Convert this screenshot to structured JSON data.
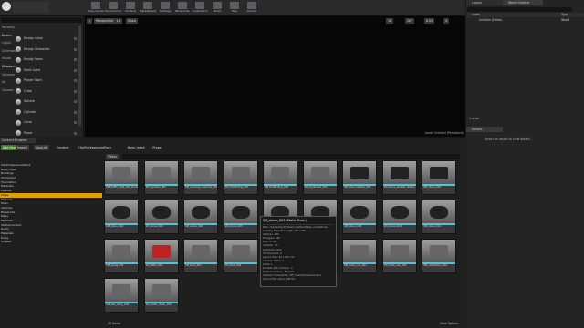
{
  "toolbar": {
    "buttons": [
      "Save Current",
      "Source Control",
      "Content",
      "Marketplace",
      "Settings",
      "Blueprints",
      "Cinematics",
      "Build",
      "Play",
      "Launch"
    ]
  },
  "left_panel": {
    "search_placeholder": "Search Classes",
    "categories": [
      "Recently Placed",
      "Basic",
      "Lights",
      "Cinematic",
      "Visual Effects",
      "Geometry",
      "Volumes",
      "All Classes"
    ],
    "items": [
      "Empty Actor",
      "Empty Character",
      "Empty Pawn",
      "Point Light",
      "Player Start",
      "Cube",
      "Sphere",
      "Cylinder",
      "Cone",
      "Plane"
    ]
  },
  "viewport": {
    "perspective": "Perspective",
    "lit": "Lit",
    "show": "Show",
    "snap_values": [
      "10",
      "10°",
      "0.25",
      "4"
    ],
    "level_label": "Level: Untitled (Persistent)"
  },
  "right_panel": {
    "tabs": [
      "Layers",
      "World Outliner"
    ],
    "search_placeholder": "Search...",
    "col_label": "Label",
    "col_type": "Type",
    "rows": [
      {
        "label": "Untitled (Editor)",
        "type": "World"
      }
    ],
    "actor_count": "1 actor",
    "details_tab": "Details",
    "details_empty": "Select an object to view details."
  },
  "content_browser": {
    "tab": "Content Browser",
    "add_new": "Add New",
    "import": "Import",
    "save_all": "Save All",
    "breadcrumb": [
      "Content",
      "CityProfessionalsPack",
      "Base_mesh",
      "Props"
    ],
    "filters": "Filters",
    "search_placeholder": "Search Props",
    "item_count": "31 items",
    "view_options": "View Options",
    "tree": [
      "CityProfessionalsPack",
      "Base_mesh",
      "Buildings",
      "Characters",
      "Foundation",
      "Materials",
      "Meshes",
      "Props",
      "Textures",
      "Trees",
      "Vehicles",
      "Blueprints",
      "Maps",
      "Particles",
      "StarterContent",
      "Audio",
      "Materials",
      "Props",
      "Shapes"
    ],
    "selected_tree_index": 7,
    "assets": [
      "SM_traffic_light_the_fountains_001",
      "SM_hydrant_001",
      "SM_vending_machine_001",
      "SM_toolfinding_001",
      "SM_toolfinding_002",
      "SM_signboard_001",
      "SM_solar_battery_001",
      "SM_stone_sholder_station_001",
      "SM_stone_001",
      "SM_stone_002",
      "SM_stone_003",
      "SM_stone_004",
      "SM_stone_005",
      "SM_stone_006",
      "SM_stone_007",
      "SM_stone_008",
      "SM_stone_009",
      "SM_stone_010",
      "SM_swing_001",
      "SM_table_001",
      "SM_tank_001",
      "SM_tank_002",
      "SM_tank_003",
      "SM_tank_004",
      "SM_trash_can_001",
      "SM_trash_can_002",
      "SM_ventilation_001",
      "SM_wall_lamp_001",
      "SM_water_tower_001"
    ],
    "tooltip": {
      "title": "SM_stone_005 (Static Mesh)",
      "rows": [
        "Path: /Game/CityProfessionalsPack/Base_mesh/Props",
        "Cooking Filepath Length: 183 / 260",
        "Vertices: 144",
        "Triangles: 146",
        "Size: 17 KB",
        "Collision: 40",
        "Lightmap: false",
        "UV Channels: 2",
        "Approx Size: 64 x 68 x 22",
        "Collision Prims: 1",
        "LODs: 1",
        "Sockets with Collision: 0",
        "Default Collision: BlockAll",
        "Collision Complexity: CTF_UseSimpleAsComplex",
        "Source File: stone_005.fbx"
      ]
    }
  }
}
